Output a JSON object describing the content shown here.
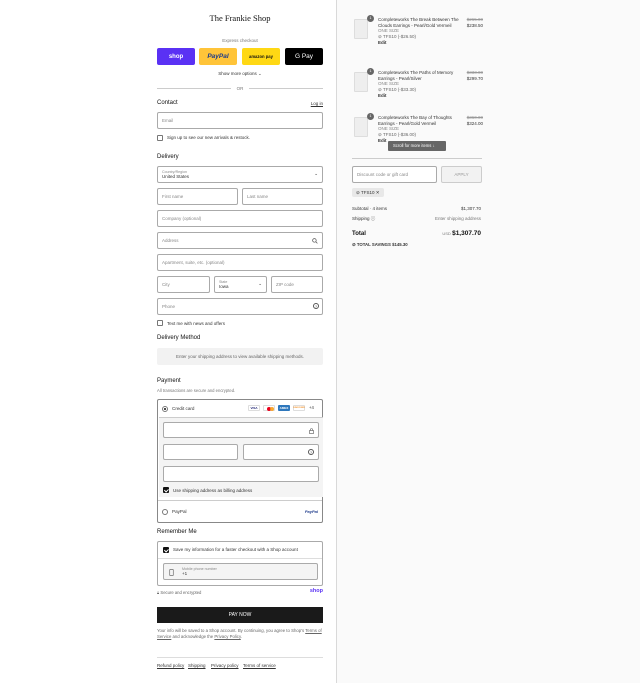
{
  "shop": {
    "title": "The Frankie Shop"
  },
  "express": {
    "label": "Express checkout",
    "shop_pay": "shop",
    "paypal": "PayPal",
    "amazon": "amazon pay",
    "gpay": "G Pay",
    "more_options": "Show more options",
    "or": "OR"
  },
  "contact": {
    "heading": "Contact",
    "login": "Log in",
    "email_placeholder": "Email",
    "signup_label": "Sign up to see our new arrivals & restock."
  },
  "delivery": {
    "heading": "Delivery",
    "country_label": "Country/Region",
    "country_value": "United States",
    "first_name": "First name",
    "last_name": "Last name",
    "company": "Company (optional)",
    "address": "Address",
    "apartment": "Apartment, suite, etc. (optional)",
    "city": "City",
    "state_label": "State",
    "state_value": "Iowa",
    "zip": "ZIP code",
    "phone": "Phone",
    "text_me": "Text me with news and offers"
  },
  "delivery_method": {
    "heading": "Delivery Method",
    "message": "Enter your shipping address to view available shipping methods."
  },
  "payment": {
    "heading": "Payment",
    "subtitle": "All transactions are secure and encrypted.",
    "credit_card": "Credit card",
    "card_logos": [
      "VISA",
      "MC",
      "AMEX",
      "DISCOVER"
    ],
    "more_cards": "+4",
    "billing_same": "Use shipping address as billing address",
    "paypal": "PayPal",
    "paypal_logo": "PayPal"
  },
  "remember": {
    "heading": "Remember Me",
    "save_info": "Save my information for a faster checkout with a Shop account",
    "mobile_label": "Mobile phone number",
    "mobile_value": "+1",
    "secure": "Secure and encrypted",
    "shop_logo": "shop"
  },
  "pay_now": "PAY NOW",
  "legal": {
    "text": "Your info will be saved to a Shop account. By continuing, you agree to Shop's",
    "tos": "Terms of Service",
    "and": "and acknowledge the",
    "privacy": "Privacy Policy",
    "end": "."
  },
  "footer": [
    "Refund policy",
    "Shipping",
    "Privacy policy",
    "Terms of service"
  ],
  "cart": {
    "items": [
      {
        "qty": "1",
        "name": "Completeworks The Break Between The Clouds Earrings - Pearl/Gold Vermeil",
        "size": "ONE SIZE",
        "discount": "TFS10 (-$26.50)",
        "edit": "Edit",
        "old_price": "$265.00",
        "price": "$238.50"
      },
      {
        "qty": "1",
        "name": "Completeworks The Paths of Memory Earrings - Pearl/Silver",
        "size": "ONE SIZE",
        "discount": "TFS10 (-$33.30)",
        "edit": "Edit",
        "old_price": "$333.00",
        "price": "$299.70"
      },
      {
        "qty": "1",
        "name": "Completeworks The Bay of Thoughts Earrings - Pearl/Gold Vermeil",
        "size": "ONE SIZE",
        "discount": "TFS10 (-$36.00)",
        "edit": "Edit",
        "old_price": "$360.00",
        "price": "$324.00"
      }
    ],
    "scroll_hint": "Scroll for more items",
    "discount_placeholder": "Discount code or gift card",
    "apply": "APPLY",
    "code_tag": "TFS10",
    "subtotal_label": "Subtotal · 4 items",
    "subtotal_value": "$1,307.70",
    "shipping_label": "Shipping",
    "shipping_value": "Enter shipping address",
    "total_label": "Total",
    "currency": "USD",
    "total_value": "$1,307.70",
    "savings_label": "TOTAL SAVINGS",
    "savings_value": "$145.30"
  },
  "colors": {
    "shop_pay": "#5a31f4",
    "paypal": "#ffc439",
    "amazon": "#ffd814",
    "gpay": "#000000",
    "pay_now": "#1a1a1a"
  }
}
